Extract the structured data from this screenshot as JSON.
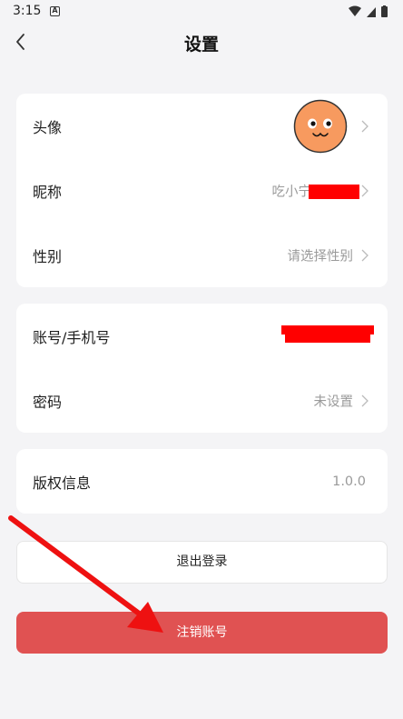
{
  "status": {
    "time": "3:15",
    "notification": "A"
  },
  "header": {
    "title": "设置"
  },
  "profile_card": {
    "avatar_label": "头像",
    "nickname_label": "昵称",
    "nickname_value": "吃小宁",
    "gender_label": "性别",
    "gender_placeholder": "请选择性别"
  },
  "account_card": {
    "account_label": "账号/手机号",
    "password_label": "密码",
    "password_value": "未设置"
  },
  "info_card": {
    "copyright_label": "版权信息",
    "version": "1.0.0"
  },
  "actions": {
    "logout_label": "退出登录",
    "cancel_account_label": "注销账号"
  },
  "colors": {
    "background": "#f4f4f6",
    "card": "#ffffff",
    "danger": "#e05252",
    "redaction": "#ff0000",
    "annotation_arrow": "#ee1111",
    "avatar": "#f79a5f"
  }
}
